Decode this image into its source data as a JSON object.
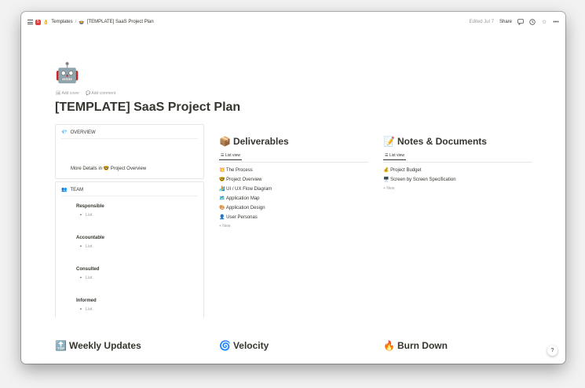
{
  "topbar": {
    "notification_count": "5",
    "breadcrumb": [
      "Templates",
      "[TEMPLATE] SaaS Project Plan"
    ],
    "breadcrumb_icons": [
      "👌",
      "🍲"
    ],
    "edited": "Edited Jul 7",
    "share": "Share",
    "icons": [
      "comment-icon",
      "clock-icon",
      "star-icon",
      "more-icon"
    ]
  },
  "page": {
    "icon": "🤖",
    "add_cover": "Add cover",
    "add_comment": "Add comment",
    "title": "[TEMPLATE] SaaS Project Plan"
  },
  "overview": {
    "icon": "💎",
    "title": "OVERVIEW",
    "more_prefix": "More Details in",
    "link_icon": "🤓",
    "link_text": "Project Overview"
  },
  "team": {
    "icon": "👥",
    "title": "TEAM",
    "roles": [
      {
        "name": "Responsible",
        "item": "List"
      },
      {
        "name": "Accountable",
        "item": "List"
      },
      {
        "name": "Consulted",
        "item": "List"
      },
      {
        "name": "Informed",
        "item": "List"
      }
    ]
  },
  "deliverables": {
    "icon": "📦",
    "title": "Deliverables",
    "tab": "List view",
    "items": [
      {
        "icon": "💥",
        "label": "The Process"
      },
      {
        "icon": "🤓",
        "label": "Project Overview"
      },
      {
        "icon": "🏄",
        "label": "UI / UX Flow Diagram"
      },
      {
        "icon": "🗺️",
        "label": "Application Map"
      },
      {
        "icon": "🎨",
        "label": "Application Design"
      },
      {
        "icon": "👤",
        "label": "User Personas"
      }
    ],
    "new": "+ New"
  },
  "notes": {
    "icon": "📝",
    "title": "Notes & Documents",
    "tab": "List view",
    "items": [
      {
        "icon": "💰",
        "label": "Project Budget"
      },
      {
        "icon": "🖥️",
        "label": "Screen by Screen Specification"
      }
    ],
    "new": "+ New"
  },
  "bottom_sections": [
    {
      "icon": "🔝",
      "title": "Weekly Updates"
    },
    {
      "icon": "🌀",
      "title": "Velocity"
    },
    {
      "icon": "🔥",
      "title": "Burn Down"
    }
  ],
  "help": "?"
}
